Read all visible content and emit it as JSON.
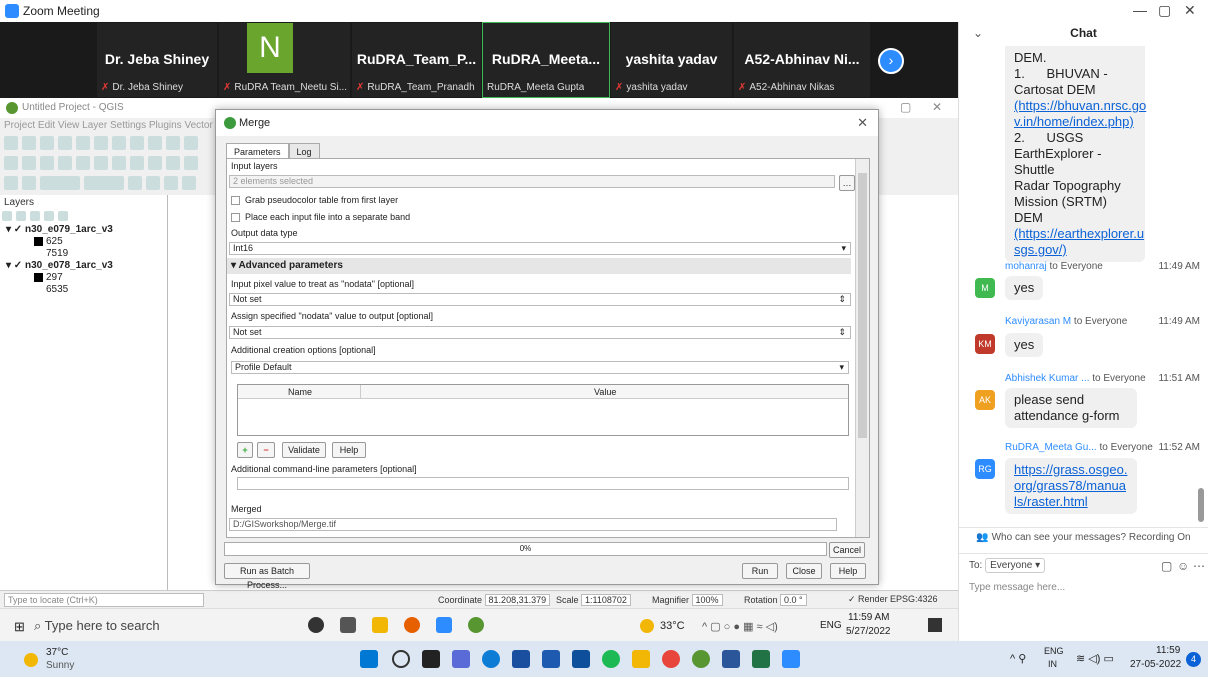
{
  "window": {
    "title": "Zoom Meeting"
  },
  "participants": [
    {
      "name": "Dr. Jeba Shiney",
      "sub": "Dr. Jeba Shiney"
    },
    {
      "name": "",
      "initial": "N",
      "sub": "RuDRA Team_Neetu Si..."
    },
    {
      "name": "RuDRA_Team_P...",
      "sub": "RuDRA_Team_Pranadh"
    },
    {
      "name": "RuDRA_Meeta...",
      "sub": "RuDRA_Meeta Gupta"
    },
    {
      "name": "yashita yadav",
      "sub": "yashita yadav"
    },
    {
      "name": "A52-Abhinav Ni...",
      "sub": "A52-Abhinav Nikas"
    }
  ],
  "qgis": {
    "title": "Untitled Project - QGIS",
    "menu": "Project  Edit  View  Layer  Settings  Plugins  Vector",
    "layers_header": "Layers",
    "layers": [
      {
        "name": "n30_e079_1arc_v3",
        "v1": "625",
        "v2": "7519"
      },
      {
        "name": "n30_e078_1arc_v3",
        "v1": "297",
        "v2": "6535"
      }
    ],
    "locate_placeholder": "Type to locate (Ctrl+K)",
    "coordinate_label": "Coordinate",
    "coordinate": "81.208,31.379",
    "scale_label": "Scale",
    "scale": "1:1108702",
    "magnifier_label": "Magnifier",
    "magnifier": "100%",
    "rotation_label": "Rotation",
    "rotation": "0.0 °",
    "render_label": "Render",
    "crs": "EPSG:4326"
  },
  "dialog": {
    "title": "Merge",
    "tabs": [
      "Parameters",
      "Log"
    ],
    "input_layers_label": "Input layers",
    "input_layers_value": "2 elements selected",
    "grab_pseudocolor": "Grab pseudocolor table from first layer",
    "separate_band": "Place each input file into a separate band",
    "output_type_label": "Output data type",
    "output_type_value": "Int16",
    "advanced": "Advanced parameters",
    "nodata_input_label": "Input pixel value to treat as \"nodata\" [optional]",
    "nodata_input_value": "Not set",
    "nodata_output_label": "Assign specified \"nodata\" value to output [optional]",
    "nodata_output_value": "Not set",
    "creation_label": "Additional creation options [optional]",
    "profile_label": "Profile",
    "profile_value": "Default",
    "col_name": "Name",
    "col_value": "Value",
    "validate": "Validate",
    "help_small": "Help",
    "cmdline_label": "Additional command-line parameters [optional]",
    "merged_label": "Merged",
    "merged_value": "D:/GISworkshop/Merge.tif",
    "progress": "0%",
    "progress_value": 0,
    "cancel": "Cancel",
    "batch": "Run as Batch Process...",
    "run": "Run",
    "close": "Close",
    "help": "Help"
  },
  "taskbar1": {
    "search": "Type here to search",
    "weather": "33°C",
    "lang": "ENG",
    "time": "11:59 AM",
    "date": "5/27/2022"
  },
  "chat": {
    "title": "Chat",
    "first_bubble": [
      "DEM.",
      "1.      BHUVAN -",
      "Cartosat DEM",
      "(https://bhuvan.nrsc.go",
      "v.in/home/index.php)",
      "2.      USGS",
      "EarthExplorer  - Shuttle",
      "Radar Topography",
      "Mission (SRTM) DEM",
      "(https://earthexplorer.u",
      "sgs.gov/)"
    ],
    "messages": [
      {
        "from": "mohanraj",
        "to": "to Everyone",
        "time": "11:49 AM",
        "initials": "M",
        "color": "#3fb950",
        "text": "yes"
      },
      {
        "from": "Kaviyarasan M",
        "to": "to Everyone",
        "time": "11:49 AM",
        "initials": "KM",
        "color": "#c0392b",
        "text": "yes"
      },
      {
        "from": "Abhishek Kumar ...",
        "to": "to Everyone",
        "time": "11:51 AM",
        "initials": "AK",
        "color": "#f0a020",
        "text": "please send attendance g-form"
      },
      {
        "from": "RuDRA_Meeta Gu...",
        "to": "to Everyone",
        "time": "11:52 AM",
        "initials": "RG",
        "color": "#2d8cff",
        "text": "https://grass.osgeo.org/grass78/manuals/raster.html"
      }
    ],
    "notice": "Who can see your messages? Recording On",
    "to_label": "To:",
    "to_value": "Everyone",
    "input_placeholder": "Type message here..."
  },
  "taskbar2": {
    "weather_temp": "37°C",
    "weather_desc": "Sunny",
    "lang1": "ENG",
    "lang2": "IN",
    "time": "11:59",
    "date": "27-05-2022",
    "badge": "4"
  }
}
